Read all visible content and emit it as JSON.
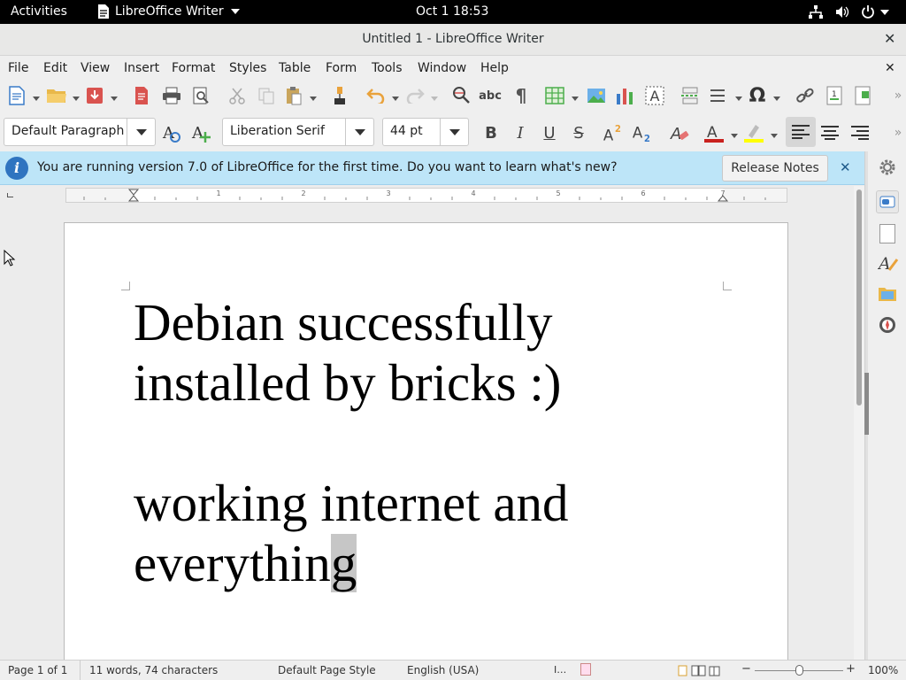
{
  "topbar": {
    "activities": "Activities",
    "app_menu": "LibreOffice Writer",
    "clock": "Oct 1  18:53"
  },
  "window": {
    "title": "Untitled 1 - LibreOffice Writer"
  },
  "menu": [
    "File",
    "Edit",
    "View",
    "Insert",
    "Format",
    "Styles",
    "Table",
    "Form",
    "Tools",
    "Window",
    "Help"
  ],
  "formatting": {
    "paragraph_style": "Default Paragraph",
    "font_name": "Liberation Serif",
    "font_size": "44 pt",
    "bold": "B",
    "italic": "I",
    "underline": "U",
    "strike": "S"
  },
  "infobar": {
    "message": "You are running version 7.0 of LibreOffice for the first time. Do you want to learn what's new?",
    "button": "Release Notes"
  },
  "document": {
    "lines": [
      "Debian successfully",
      "installed by bricks :)",
      "working internet and",
      "everythin"
    ],
    "last_char": "g"
  },
  "statusbar": {
    "page": "Page 1 of 1",
    "words": "11 words, 74 characters",
    "page_style": "Default Page Style",
    "language": "English (USA)",
    "zoom": "100%"
  },
  "colors": {
    "infobar_bg": "#bde5f8",
    "font_color": "#c9211e",
    "highlight": "#ffff00"
  }
}
